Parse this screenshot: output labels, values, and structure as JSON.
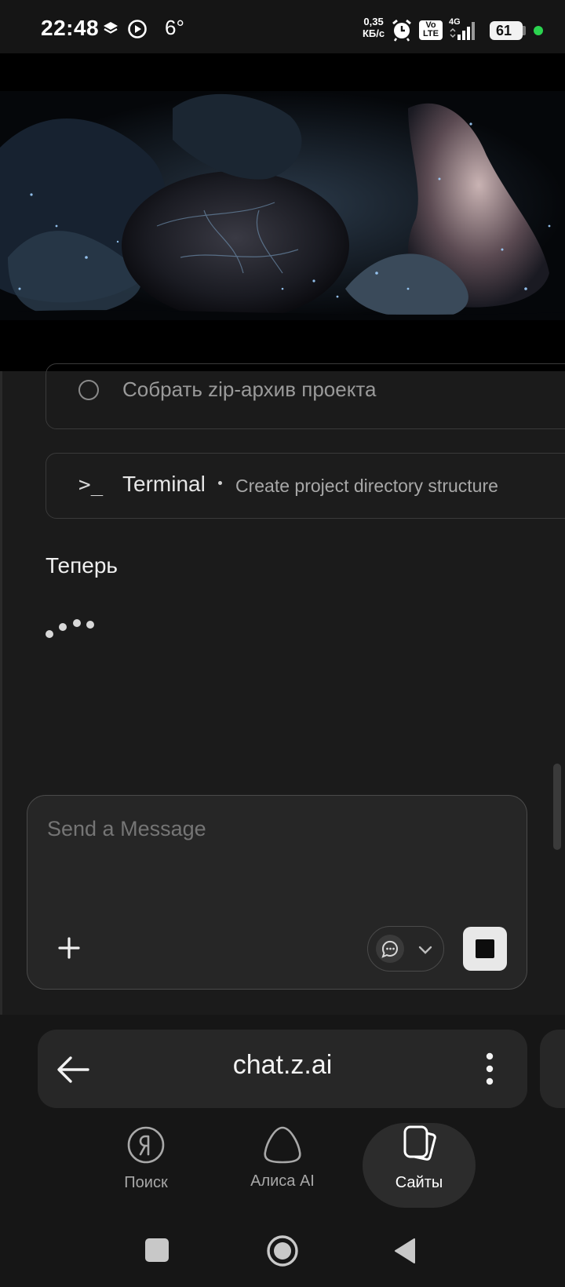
{
  "status_bar": {
    "time": "22:48",
    "temperature": "6°",
    "net_speed_value": "0,35",
    "net_speed_unit": "КБ/с",
    "volte_line1": "Vo",
    "volte_line2": "LTE",
    "network_type": "4G",
    "battery": "61",
    "icons": [
      "layers-icon",
      "play-circle-icon",
      "alarm-icon",
      "signal-icon",
      "battery-icon",
      "green-dot-indicator"
    ]
  },
  "chat": {
    "task_item": "Собрать zip-архив проекта",
    "tool_card": {
      "icon": "terminal-icon",
      "title": "Terminal",
      "description": "Create project directory structure"
    },
    "partial_response": "Теперь"
  },
  "composer": {
    "placeholder": "Send a Message",
    "add_icon": "plus-icon",
    "mode_icons": [
      "chat-bubble-icon",
      "chevron-down-icon"
    ],
    "stop_icon": "stop-icon"
  },
  "browser": {
    "url": "chat.z.ai",
    "back_icon": "arrow-left-icon",
    "menu_icon": "more-vertical-icon"
  },
  "bottom_nav": {
    "items": [
      {
        "label": "Поиск",
        "icon": "yandex-search-icon",
        "active": false
      },
      {
        "label": "Алиса AI",
        "icon": "alice-icon",
        "active": false
      },
      {
        "label": "Сайты",
        "icon": "tabs-icon",
        "active": true
      }
    ]
  },
  "system_nav": {
    "icons": [
      "recents-square-icon",
      "home-circle-icon",
      "back-triangle-icon"
    ]
  },
  "colors": {
    "background": "#161616",
    "chat_background": "#1b1b1b",
    "card_border": "#3a3a3a",
    "status_green": "#2bd34f"
  }
}
